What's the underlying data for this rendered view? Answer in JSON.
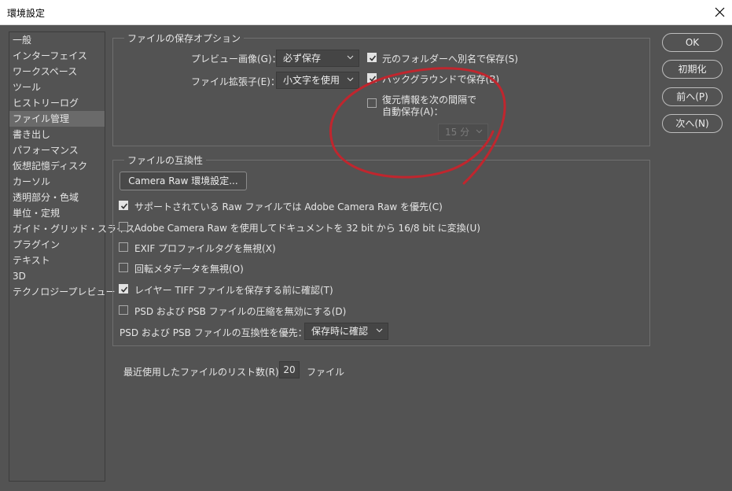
{
  "window": {
    "title": "環境設定"
  },
  "sidebar": {
    "items": [
      {
        "label": "一般"
      },
      {
        "label": "インターフェイス"
      },
      {
        "label": "ワークスペース"
      },
      {
        "label": "ツール"
      },
      {
        "label": "ヒストリーログ"
      },
      {
        "label": "ファイル管理",
        "selected": true
      },
      {
        "label": "書き出し"
      },
      {
        "label": "パフォーマンス"
      },
      {
        "label": "仮想記憶ディスク"
      },
      {
        "label": "カーソル"
      },
      {
        "label": "透明部分・色域"
      },
      {
        "label": "単位・定規"
      },
      {
        "label": "ガイド・グリッド・スライス"
      },
      {
        "label": "プラグイン"
      },
      {
        "label": "テキスト"
      },
      {
        "label": "3D"
      },
      {
        "label": "テクノロジープレビュー"
      }
    ]
  },
  "save_options": {
    "legend": "ファイルの保存オプション",
    "preview_label": "プレビュー画像(G)：",
    "preview_value": "必ず保存",
    "ext_label": "ファイル拡張子(E)：",
    "ext_value": "小文字を使用",
    "save_as_to_original": {
      "label": "元のフォルダーへ別名で保存(S)",
      "checked": true
    },
    "background_save": {
      "label": "バックグラウンドで保存(B)",
      "checked": true
    },
    "auto_save": {
      "label_line1": "復元情報を次の間隔で",
      "label_line2": "自動保存(A)：",
      "checked": false
    },
    "auto_save_interval": "15 分"
  },
  "compat": {
    "legend": "ファイルの互換性",
    "camera_raw_button": "Camera Raw 環境設定...",
    "options": [
      {
        "label": "サポートされている Raw ファイルでは Adobe Camera Raw を優先(C)",
        "checked": true
      },
      {
        "label": "Adobe Camera Raw を使用してドキュメントを 32 bit から 16/8 bit に変換(U)",
        "checked": false
      },
      {
        "label": "EXIF プロファイルタグを無視(X)",
        "checked": false
      },
      {
        "label": "回転メタデータを無視(O)",
        "checked": false
      },
      {
        "label": "レイヤー TIFF ファイルを保存する前に確認(T)",
        "checked": true
      },
      {
        "label": "PSD および PSB ファイルの圧縮を無効にする(D)",
        "checked": false
      }
    ],
    "psd_compat_label": "PSD および PSB ファイルの互換性を優先：",
    "psd_compat_value": "保存時に確認"
  },
  "recent": {
    "label": "最近使用したファイルのリスト数(R)：",
    "value": "20",
    "unit": "ファイル"
  },
  "buttons": {
    "ok": "OK",
    "reset": "初期化",
    "prev": "前へ(P)",
    "next": "次へ(N)"
  },
  "colors": {
    "background": "#535353",
    "annotation": "#c0262e"
  }
}
